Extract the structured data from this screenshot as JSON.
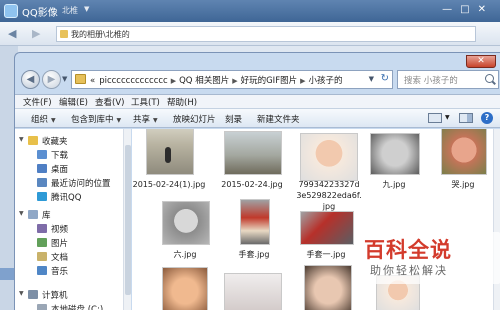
{
  "background_window": {
    "title": "QQ影像",
    "user": "北椎",
    "user_caret": "▼",
    "back_icon": "◀",
    "forward_icon": "▶",
    "path": "我的相册\\北椎的",
    "controls": "—□✕"
  },
  "explorer": {
    "close_glyph": "✕",
    "back_icon": "◀",
    "forward_icon": "▶",
    "history_caret": "▼",
    "breadcrumb": [
      "«",
      "piccccccccccccc",
      "QQ 相关图片",
      "好玩的GIF图片",
      "小孩子的"
    ],
    "breadcrumb_separator": "▶",
    "address_dropdown": "▼",
    "refresh_icon": "↻",
    "search_placeholder": "搜索 小孩子的",
    "menu": [
      "文件(F)",
      "编辑(E)",
      "查看(V)",
      "工具(T)",
      "帮助(H)"
    ],
    "commands": [
      {
        "label": "组织",
        "caret": "▼"
      },
      {
        "label": "包含到库中",
        "caret": "▼"
      },
      {
        "label": "共享",
        "caret": "▼"
      },
      {
        "label": "放映幻灯片",
        "caret": ""
      },
      {
        "label": "刻录",
        "caret": ""
      },
      {
        "label": "新建文件夹",
        "caret": ""
      }
    ],
    "view_caret": "▼",
    "help_glyph": "?",
    "nav_pane": {
      "favorites": {
        "label": "收藏夹",
        "arrow": "▼",
        "items": [
          "下载",
          "桌面",
          "最近访问的位置",
          "腾讯QQ"
        ]
      },
      "libraries": {
        "label": "库",
        "arrow": "▼",
        "items": [
          "视频",
          "图片",
          "文档",
          "音乐"
        ]
      },
      "computer": {
        "label": "计算机",
        "arrow": "▼",
        "items": [
          "本地磁盘 (C:)"
        ]
      }
    },
    "files": [
      {
        "name": "2015-02-24(1).jpg",
        "thumb": "t-mono"
      },
      {
        "name": "2015-02-24.jpg",
        "thumb": "t-land"
      },
      {
        "name": "79934223327d3e529822eda6f.jpg",
        "thumb": "t-baby1"
      },
      {
        "name": "九.jpg",
        "thumb": "t-baby2"
      },
      {
        "name": "哭.jpg",
        "thumb": "t-cry"
      },
      {
        "name": "六.jpg",
        "thumb": "t-grey"
      },
      {
        "name": "手套.jpg",
        "thumb": "t-ww"
      },
      {
        "name": "手套一.jpg",
        "thumb": "t-ww2"
      },
      {
        "name": "",
        "thumb": "t-baby3"
      },
      {
        "name": "",
        "thumb": "t-plain"
      },
      {
        "name": "",
        "thumb": "t-baby4"
      },
      {
        "name": "",
        "thumb": "t-baby1"
      }
    ]
  },
  "watermark": {
    "title": "百科全说",
    "subtitle": "助你轻松解决"
  }
}
